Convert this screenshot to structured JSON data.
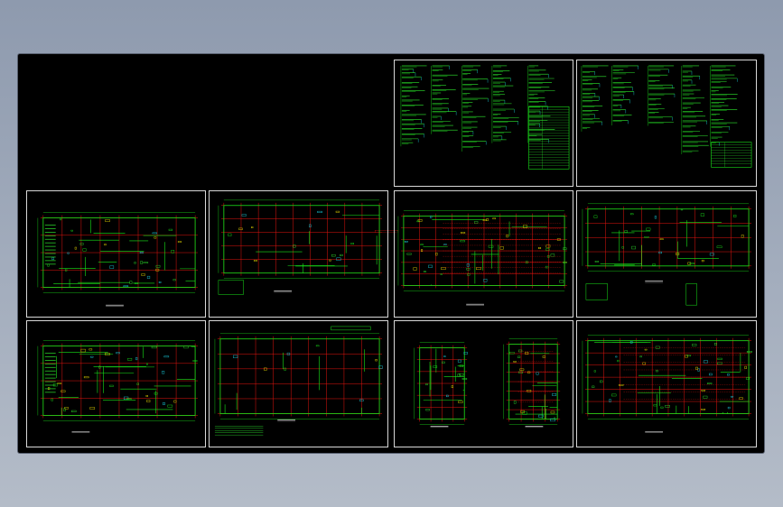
{
  "drawing": {
    "background_color": "#000000",
    "colors": {
      "frame": "#ffffff",
      "grid": "#e8140f",
      "walls": "#19e619",
      "text": "#2ee82e",
      "cyan": "#19d6e6",
      "yellow": "#f0e000",
      "magenta": "#e619e6"
    },
    "title_stamp_icon": "title-stamp-icon",
    "sheets": [
      {
        "id": "system-diagram-1",
        "kind": "diagram"
      },
      {
        "id": "system-diagram-2",
        "kind": "diagram"
      },
      {
        "id": "floor-plan-1",
        "kind": "plan"
      },
      {
        "id": "floor-plan-2",
        "kind": "plan"
      },
      {
        "id": "floor-plan-3",
        "kind": "plan"
      },
      {
        "id": "floor-plan-4",
        "kind": "plan"
      },
      {
        "id": "floor-plan-5",
        "kind": "plan"
      },
      {
        "id": "floor-plan-6",
        "kind": "plan"
      },
      {
        "id": "floor-plan-7",
        "kind": "plan"
      },
      {
        "id": "floor-plan-8",
        "kind": "plan"
      }
    ]
  }
}
